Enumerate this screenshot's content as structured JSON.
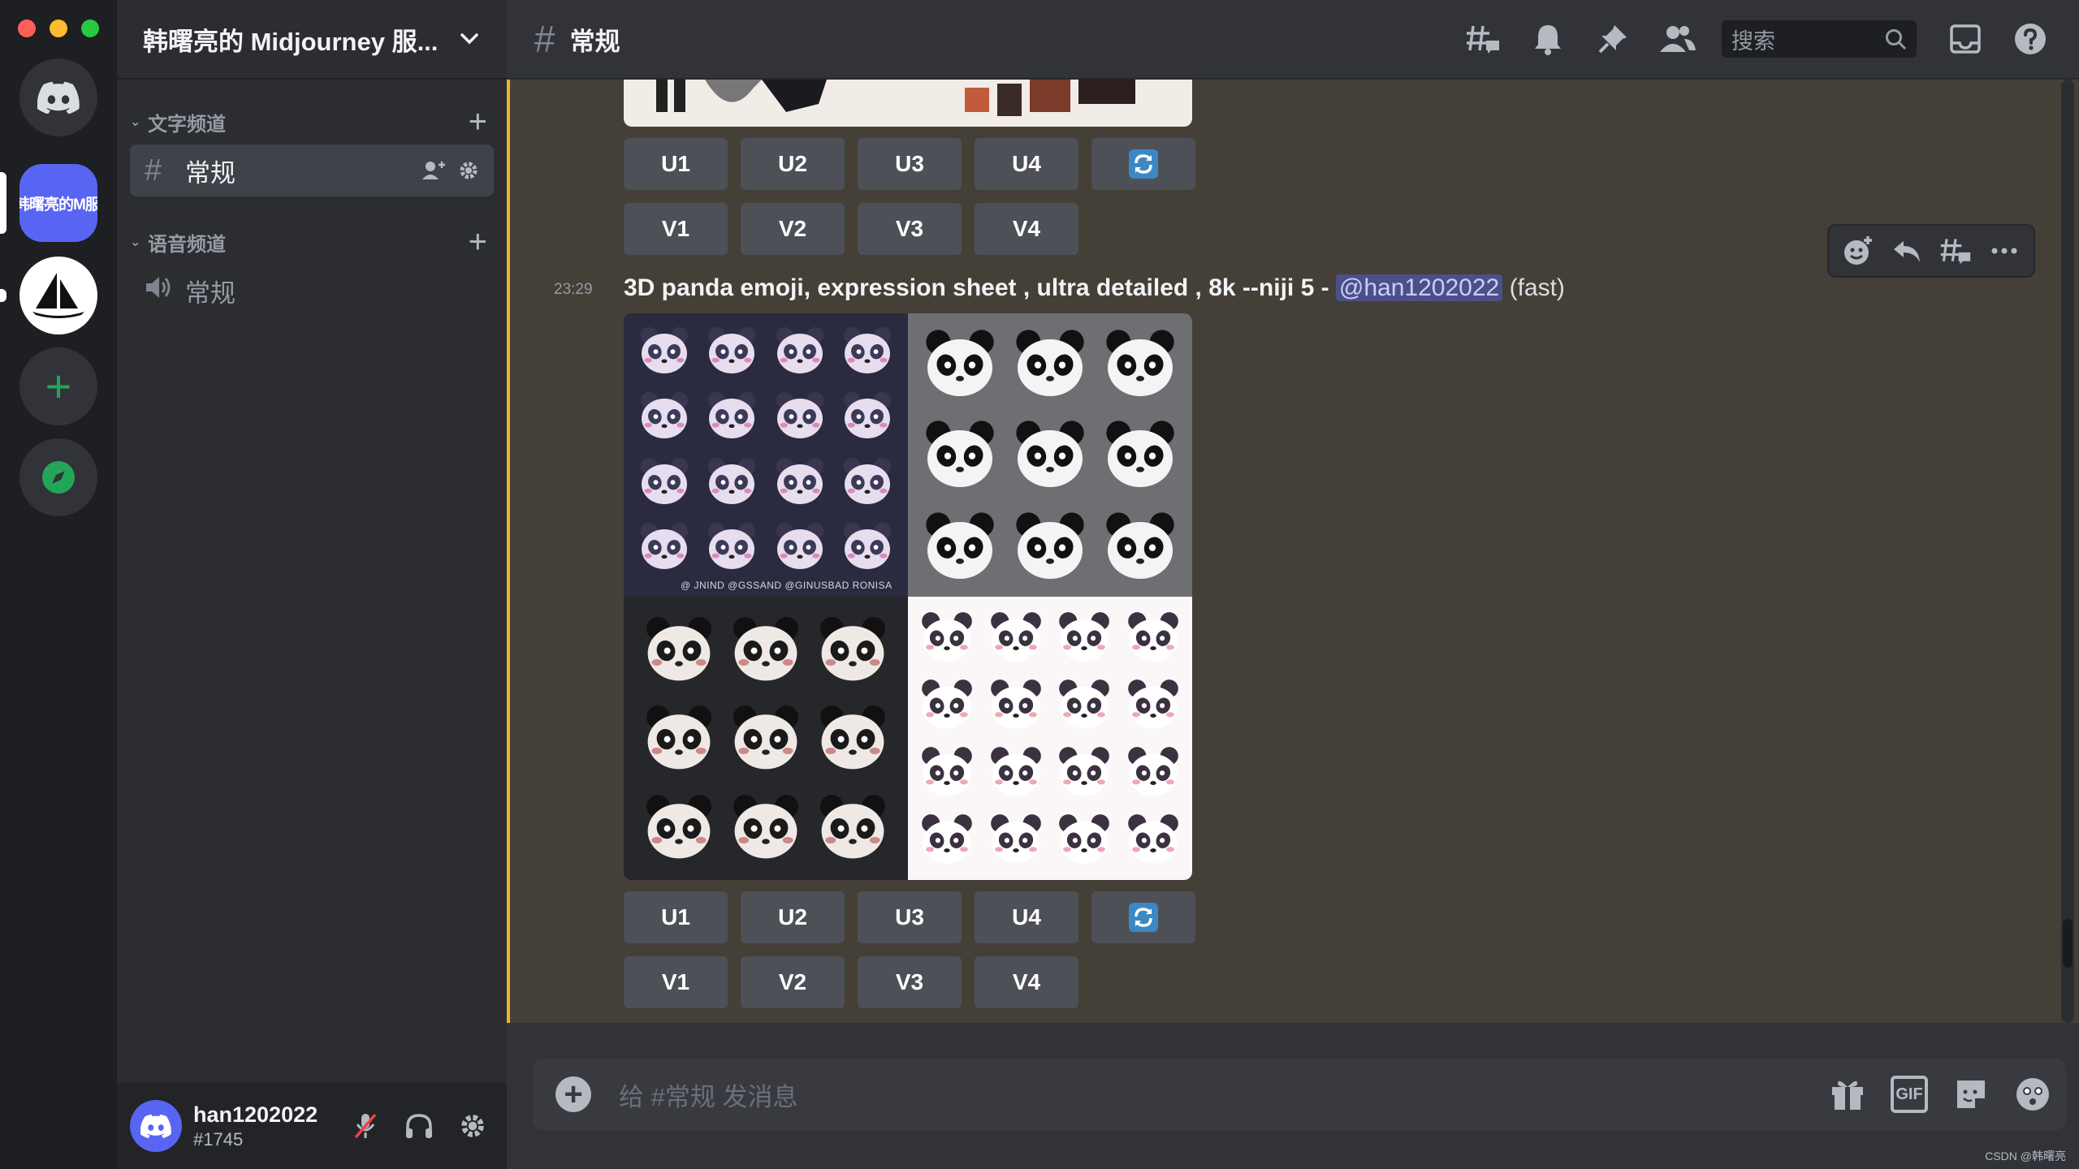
{
  "window": {
    "traffic_colors": [
      "#ff5f57",
      "#febc2e",
      "#28c840"
    ]
  },
  "servers": {
    "active_label": "韩曙亮的M服务器"
  },
  "sidebar": {
    "server_name": "韩曙亮的 Midjourney 服...",
    "text_category": "文字频道",
    "voice_category": "语音频道",
    "text_channel": "常规",
    "voice_channel": "常规"
  },
  "user": {
    "name": "han1202022",
    "tag": "#1745"
  },
  "topbar": {
    "channel": "常规",
    "search_placeholder": "搜索"
  },
  "message": {
    "time": "23:29",
    "prompt": "3D panda emoji, expression sheet , ultra detailed , 8k --niji 5 - ",
    "mention": "@han1202022",
    "speed": "(fast)",
    "watermark": "@ JNIND @GSSAND @GINUSBAD  RONISA"
  },
  "buttons": {
    "upscale": [
      "U1",
      "U2",
      "U3",
      "U4"
    ],
    "variation": [
      "V1",
      "V2",
      "V3",
      "V4"
    ]
  },
  "composer": {
    "placeholder": "给 #常规 发消息",
    "gif_label": "GIF"
  },
  "credit": "CSDN @韩曙亮",
  "colors": {
    "accent": "#5865f2",
    "highlight_bar": "#f0b232",
    "add_server": "#23a559"
  }
}
